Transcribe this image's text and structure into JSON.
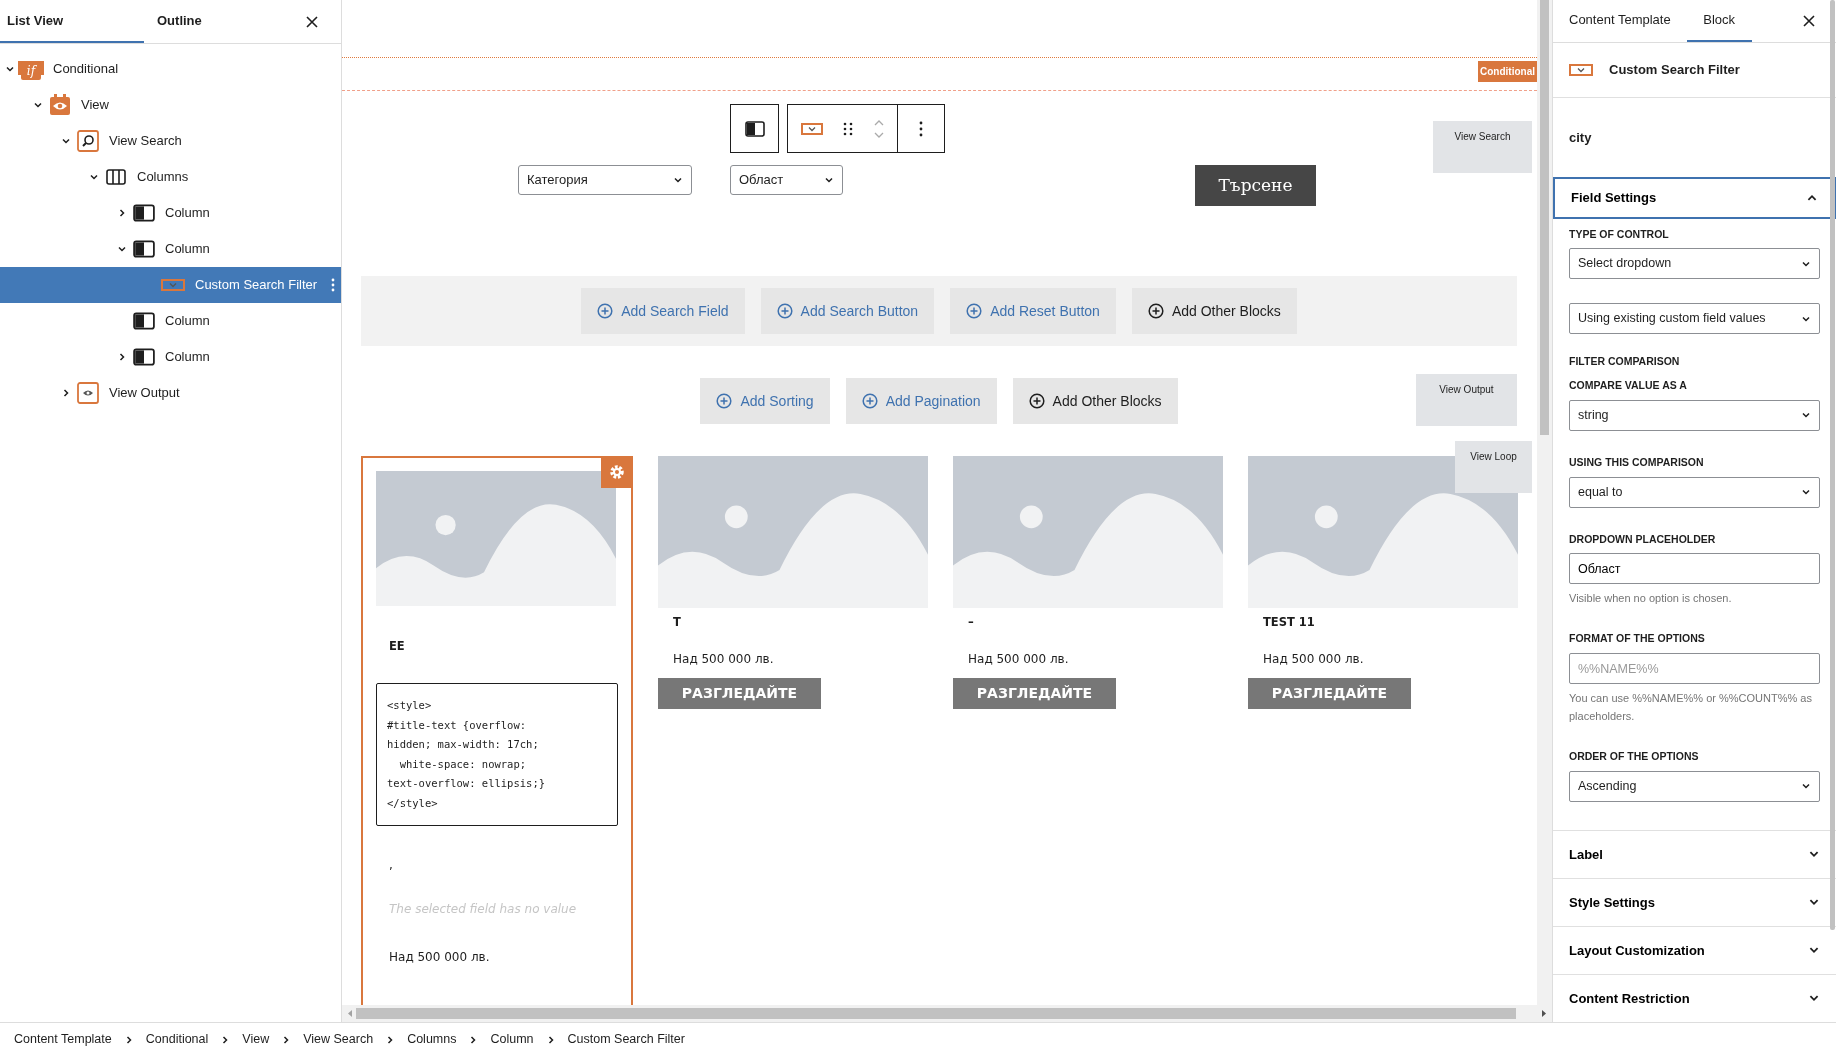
{
  "left_panel": {
    "tabs": [
      {
        "label": "List View",
        "selected": true
      },
      {
        "label": "Outline",
        "selected": false
      }
    ],
    "tree": [
      {
        "label": "Conditional",
        "kind": "conditional",
        "badge": "if",
        "expanded": true,
        "selected": false,
        "children": [
          {
            "label": "View",
            "kind": "view",
            "expanded": true,
            "selected": false,
            "children": [
              {
                "label": "View Search",
                "kind": "search",
                "expanded": true,
                "selected": false,
                "children": [
                  {
                    "label": "Columns",
                    "kind": "columns",
                    "expanded": true,
                    "selected": false,
                    "children": [
                      {
                        "label": "Column",
                        "kind": "column",
                        "expanded": false,
                        "selected": false
                      },
                      {
                        "label": "Column",
                        "kind": "column",
                        "expanded": true,
                        "selected": false,
                        "children": [
                          {
                            "label": "Custom Search Filter",
                            "kind": "filter",
                            "selected": true
                          }
                        ]
                      },
                      {
                        "label": "Column",
                        "kind": "column",
                        "selected": false
                      },
                      {
                        "label": "Column",
                        "kind": "column",
                        "expanded": false,
                        "selected": false
                      }
                    ]
                  }
                ]
              },
              {
                "label": "View Output",
                "kind": "output",
                "expanded": false,
                "selected": false
              }
            ]
          }
        ]
      }
    ]
  },
  "canvas": {
    "conditional_tag": "Conditional",
    "search_form": {
      "selects": [
        {
          "value": "Категория"
        },
        {
          "value": "Област"
        }
      ],
      "submit": "Търсене",
      "tag": "View Search"
    },
    "add_row_1": [
      {
        "label": "Add Search Field",
        "kind": "add"
      },
      {
        "label": "Add Search Button",
        "kind": "add"
      },
      {
        "label": "Add Reset Button",
        "kind": "add"
      },
      {
        "label": "Add Other Blocks",
        "kind": "other"
      }
    ],
    "add_row_2": [
      {
        "label": "Add Sorting",
        "kind": "add"
      },
      {
        "label": "Add Pagination",
        "kind": "add"
      },
      {
        "label": "Add Other Blocks",
        "kind": "other"
      }
    ],
    "output_tag": "View Output",
    "loop_tag": "View Loop",
    "cards": [
      {
        "kind": "detail",
        "selected": true,
        "title": "EE",
        "code": "<style>\n#title-text {overflow:\nhidden; max-width: 17ch;\n  white-space: nowrap;\ntext-overflow: ellipsis;}\n</style>",
        "mark": ",",
        "note": "The selected field has no value",
        "price": "Над 500 000 лв."
      },
      {
        "kind": "product",
        "selected": false,
        "title": "T",
        "price": "Над 500 000 лв.",
        "button": "РАЗГЛЕДАЙТЕ"
      },
      {
        "kind": "product",
        "selected": false,
        "title": "–",
        "price": "Над 500 000 лв.",
        "button": "РАЗГЛЕДАЙТЕ"
      },
      {
        "kind": "product",
        "selected": false,
        "title": "TEST 11",
        "price": "Над 500 000 лв.",
        "button": "РАЗГЛЕДАЙТЕ"
      }
    ]
  },
  "right_panel": {
    "tabs": [
      {
        "label": "Content Template",
        "selected": false
      },
      {
        "label": "Block",
        "selected": true
      }
    ],
    "block_name": "Custom Search Filter",
    "field_name": "city",
    "sections": [
      {
        "title": "Field Settings",
        "expanded": true,
        "fields": [
          {
            "kind": "select",
            "label": "TYPE OF CONTROL",
            "value": "Select dropdown"
          },
          {
            "kind": "select",
            "value": "Using existing custom field values"
          },
          {
            "kind": "heading",
            "text": "FILTER COMPARISON"
          },
          {
            "kind": "select",
            "label": "COMPARE VALUE AS A",
            "value": "string"
          },
          {
            "kind": "select",
            "label": "USING THIS COMPARISON",
            "value": "equal to"
          },
          {
            "kind": "input",
            "label": "DROPDOWN PLACEHOLDER",
            "value": "Област",
            "help": "Visible when no option is chosen."
          },
          {
            "kind": "input",
            "label": "FORMAT OF THE OPTIONS",
            "placeholder": "%%NAME%%",
            "help": "You can use %%NAME%% or %%COUNT%% as placeholders."
          },
          {
            "kind": "select",
            "label": "ORDER OF THE OPTIONS",
            "value": "Ascending"
          }
        ]
      },
      {
        "title": "Label",
        "expanded": false
      },
      {
        "title": "Style Settings",
        "expanded": false
      },
      {
        "title": "Layout Customization",
        "expanded": false
      },
      {
        "title": "Content Restriction",
        "expanded": false
      }
    ]
  },
  "breadcrumb": [
    "Content Template",
    "Conditional",
    "View",
    "View Search",
    "Columns",
    "Column",
    "Custom Search Filter"
  ]
}
